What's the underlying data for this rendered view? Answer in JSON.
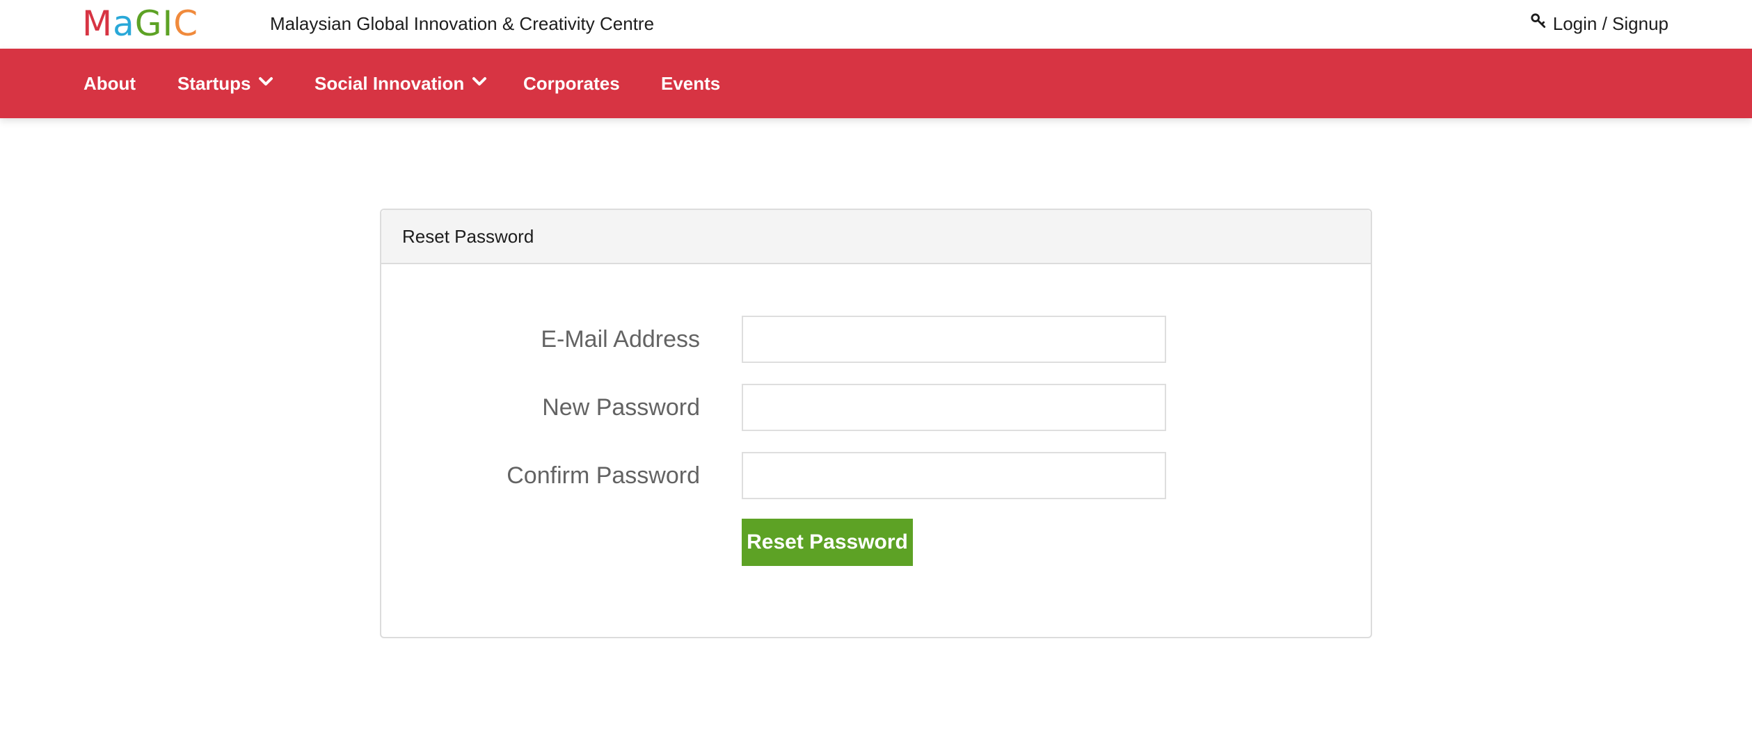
{
  "header": {
    "logo_letters": [
      {
        "char": "M",
        "color": "#d73443"
      },
      {
        "char": "a",
        "color": "#29a8d8"
      },
      {
        "char": "G",
        "color": "#5da225"
      },
      {
        "char": "I",
        "color": "#5da225"
      },
      {
        "char": "C",
        "color": "#f08a3c"
      }
    ],
    "site_name": "Malaysian Global Innovation & Creativity Centre",
    "login_label": "Login / Signup",
    "login_icon": "key-icon"
  },
  "nav": {
    "items": [
      {
        "label": "About",
        "dropdown": false
      },
      {
        "label": "Startups",
        "dropdown": true
      },
      {
        "label": "Social Innovation",
        "dropdown": true
      },
      {
        "label": "Corporates",
        "dropdown": false
      },
      {
        "label": "Events",
        "dropdown": false
      }
    ],
    "background_color": "#d73443"
  },
  "card": {
    "title": "Reset Password",
    "fields": [
      {
        "label": "E-Mail Address",
        "value": "",
        "type": "email"
      },
      {
        "label": "New Password",
        "value": "",
        "type": "password"
      },
      {
        "label": "Confirm Password",
        "value": "",
        "type": "password"
      }
    ],
    "submit_label": "Reset Password",
    "submit_color": "#5da225"
  }
}
